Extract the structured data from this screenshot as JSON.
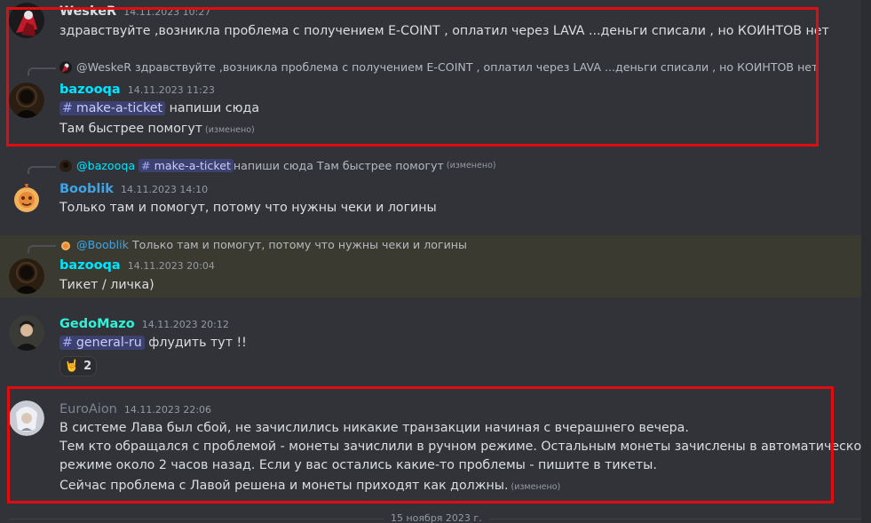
{
  "colors": {
    "background": "#313338",
    "highlight_row": "#3b3a30",
    "annotation_box": "#e00c10",
    "wesker": "#dbdee1",
    "bazooqa": "#00e5ff",
    "booblik": "#3ea4e6",
    "gedomazo": "#2ff2d8",
    "euroaion": "#7d8496"
  },
  "messages": [
    {
      "author": "WeskeR",
      "timestamp": "14.11.2023 10:27",
      "lines": [
        "здравствуйте ,возникла проблема с получением   E-COINT  , оплатил через LAVA  ...деньги списали , но КОИНТОВ нет"
      ]
    },
    {
      "reply": {
        "mention": "@WeskeR",
        "text": "здравствуйте ,возникла проблема с получением E-COINT , оплатил через LAVA ...деньги списали , но КОИНТОВ нет"
      },
      "author": "bazooqa",
      "timestamp": "14.11.2023 11:23",
      "channel": "make-a-ticket",
      "after_channel": " напиши сюда",
      "line2": "Там быстрее помогут",
      "edited": "(изменено)"
    },
    {
      "reply": {
        "mention": "@bazooqa",
        "channel": "make-a-ticket",
        "text": " напиши сюда Там быстрее помогут",
        "edited": "(изменено)"
      },
      "author": "Booblik",
      "timestamp": "14.11.2023 14:10",
      "lines": [
        "Только там и помогут, потому что нужны чеки и логины"
      ]
    },
    {
      "reply": {
        "mention": "@Booblik",
        "text": "Только там и помогут, потому что нужны чеки и логины"
      },
      "author": "bazooqa",
      "timestamp": "14.11.2023 20:04",
      "lines": [
        "Тикет / личка)"
      ]
    },
    {
      "author": "GedoMazo",
      "timestamp": "14.11.2023 20:12",
      "channel": "general-ru",
      "after_channel": " флудить тут !!",
      "reaction": {
        "emoji": "🤘",
        "count": "2"
      }
    },
    {
      "author": "EuroAion",
      "timestamp": "14.11.2023 22:06",
      "lines": [
        "В системе Лава был сбой, не зачислились никакие транзакции начиная с вчерашнего вечера.",
        "Тем кто обращался с проблемой - монеты зачислили в ручном режиме. Остальным монеты зачислены в автоматическом",
        "режиме около 2 часов назад. Если у вас остались какие-то проблемы - пишите в тикеты.",
        "Сейчас проблема с Лавой решена и монеты приходят как должны."
      ],
      "edited": "(изменено)"
    }
  ],
  "date_divider": "15 ноября 2023 г."
}
